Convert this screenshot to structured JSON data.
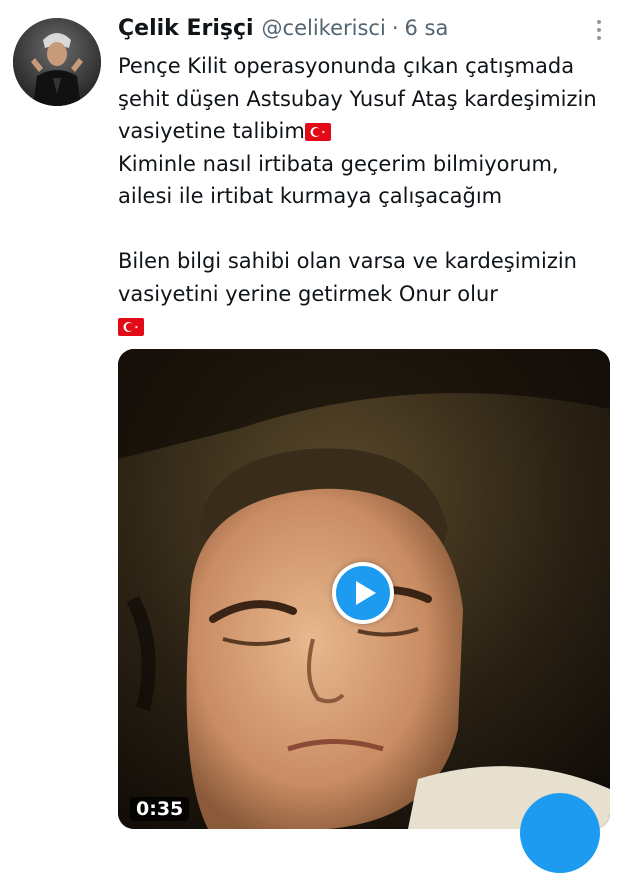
{
  "tweet": {
    "author_name": "Çelik Erişçi",
    "author_handle": "@celikerisci",
    "separator": "·",
    "time": "6 sa",
    "text_lines": [
      "Pençe Kilit operasyonunda çıkan çatışmada",
      "şehit düşen Astsubay Yusuf Ataş kardeşimizin",
      "vasiyetine talibim",
      "Kiminle nasıl irtibata geçerim bilmiyorum,",
      "ailesi ile irtibat kurmaya çalışacağım",
      "Bilen bilgi sahibi olan varsa ve kardeşimizin",
      "vasiyetini yerine getirmek Onur olur"
    ],
    "flag_icon": "turkey-flag-emoji",
    "more_icon": "vertical-ellipsis-icon"
  },
  "media": {
    "duration": "0:35",
    "play_icon": "play-icon"
  },
  "colors": {
    "accent": "#1d9bf0",
    "secondary_text": "#536471",
    "flag_red": "#e30a17"
  }
}
